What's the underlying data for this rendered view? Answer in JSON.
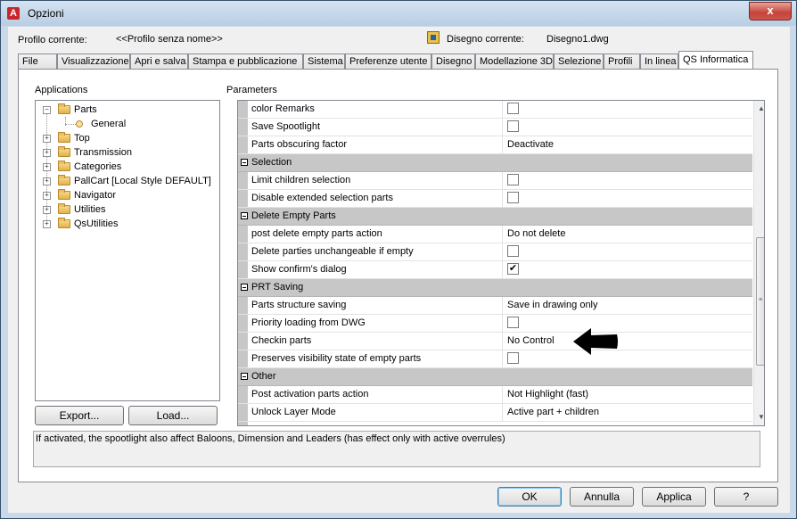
{
  "window": {
    "title": "Opzioni",
    "close_label": "x"
  },
  "profile": {
    "label": "Profilo corrente:",
    "value": "<<Profilo senza nome>>"
  },
  "drawing": {
    "label": "Disegno corrente:",
    "value": "Disegno1.dwg"
  },
  "tabs": [
    "File",
    "Visualizzazione",
    "Apri e salva",
    "Stampa e pubblicazione",
    "Sistema",
    "Preferenze utente",
    "Disegno",
    "Modellazione 3D",
    "Selezione",
    "Profili",
    "In linea",
    "QS Informatica"
  ],
  "applications": {
    "label": "Applications",
    "tree": [
      {
        "label": "Parts",
        "expanded": true
      },
      {
        "label": "General",
        "child": true
      },
      {
        "label": "Top"
      },
      {
        "label": "Transmission"
      },
      {
        "label": "Categories"
      },
      {
        "label": "PallCart [Local Style DEFAULT]"
      },
      {
        "label": "Navigator"
      },
      {
        "label": "Utilities"
      },
      {
        "label": "QsUtilities"
      }
    ],
    "export_label": "Export...",
    "load_label": "Load..."
  },
  "parameters": {
    "label": "Parameters",
    "rows": [
      {
        "kind": "prop",
        "name": "color Remarks",
        "type": "checkbox",
        "checked": false
      },
      {
        "kind": "prop",
        "name": "Save Spootlight",
        "type": "checkbox",
        "checked": false
      },
      {
        "kind": "prop",
        "name": "Parts obscuring factor",
        "type": "text",
        "value": "Deactivate"
      },
      {
        "kind": "cat",
        "name": "Selection"
      },
      {
        "kind": "prop",
        "name": "Limit children selection",
        "type": "checkbox",
        "checked": false
      },
      {
        "kind": "prop",
        "name": "Disable extended selection parts",
        "type": "checkbox",
        "checked": false
      },
      {
        "kind": "cat",
        "name": "Delete Empty Parts"
      },
      {
        "kind": "prop",
        "name": "post delete empty parts action",
        "type": "text",
        "value": "Do not delete"
      },
      {
        "kind": "prop",
        "name": "Delete parties unchangeable if empty",
        "type": "checkbox",
        "checked": false
      },
      {
        "kind": "prop",
        "name": "Show confirm's dialog",
        "type": "checkbox",
        "checked": true
      },
      {
        "kind": "cat",
        "name": "PRT Saving"
      },
      {
        "kind": "prop",
        "name": "Parts structure saving",
        "type": "text",
        "value": "Save in drawing only"
      },
      {
        "kind": "prop",
        "name": "Priority loading from DWG",
        "type": "checkbox",
        "checked": false
      },
      {
        "kind": "prop",
        "name": "Checkin parts",
        "type": "text",
        "value": "No Control"
      },
      {
        "kind": "prop",
        "name": "Preserves visibility state of empty parts",
        "type": "checkbox",
        "checked": false
      },
      {
        "kind": "cat",
        "name": "Other"
      },
      {
        "kind": "prop",
        "name": "Post activation parts action",
        "type": "text",
        "value": "Not Highlight (fast)"
      },
      {
        "kind": "prop",
        "name": "Unlock Layer Mode",
        "type": "text",
        "value": "Active part + children"
      }
    ]
  },
  "description": "If activated, the spootlight also affect Baloons, Dimension and Leaders (has effect only with active overrules)",
  "footer": {
    "ok": "OK",
    "cancel": "Annulla",
    "apply": "Applica",
    "help": "?"
  },
  "colors": {
    "category_bg": "#c7c7c7",
    "window_frame": "#c9d9ea",
    "close_button": "#c6433a"
  }
}
